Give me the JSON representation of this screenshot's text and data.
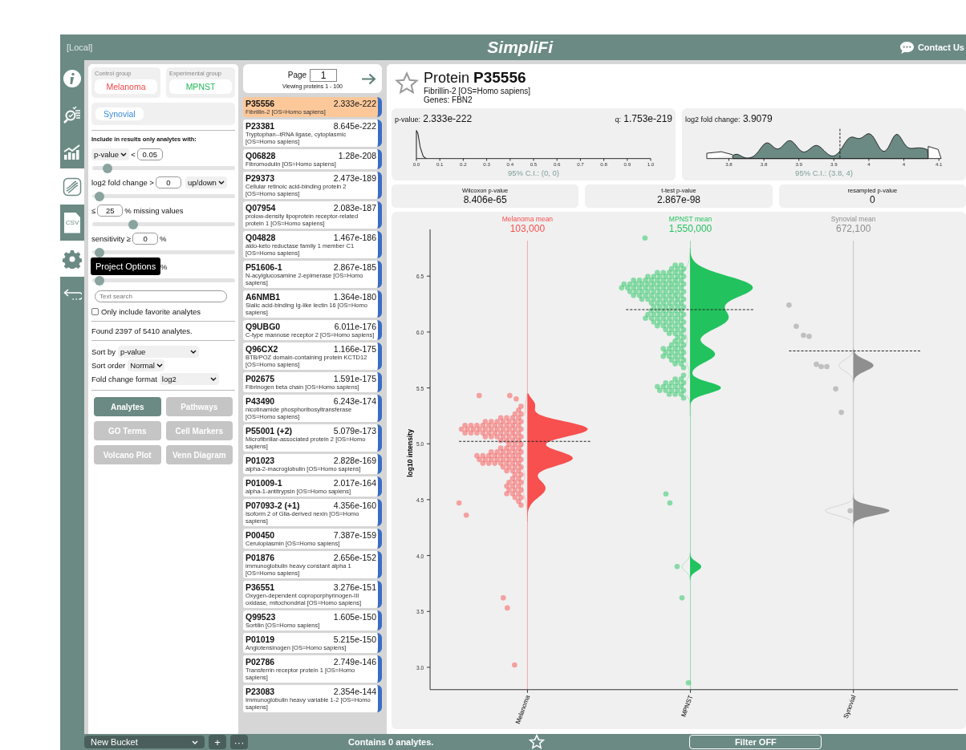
{
  "header": {
    "location": "[Local]",
    "logo": "SimpliFi",
    "contact": "Contact Us"
  },
  "rail": [
    {
      "kind": "info",
      "selected": false
    },
    {
      "kind": "search-list",
      "selected": false
    },
    {
      "kind": "chart",
      "selected": false
    },
    {
      "kind": "dna",
      "selected": true
    },
    {
      "kind": "csv",
      "label": "CSV",
      "selected": false
    },
    {
      "kind": "gear",
      "selected": true,
      "tooltip": "Project Options"
    },
    {
      "kind": "back",
      "selected": false
    }
  ],
  "groups": {
    "control": {
      "label": "Control group",
      "name": "Melanoma",
      "color": "#f04848"
    },
    "experimental": {
      "label": "Experimental group",
      "name": "MPNST",
      "color": "#22b956"
    },
    "others": [
      {
        "name": "Synovial",
        "color": "#3a8ad8"
      }
    ]
  },
  "filters": {
    "heading": "Include in results only analytes with:",
    "rows": [
      {
        "kind": "select",
        "select": "p-value",
        "op": "<",
        "value": "0.05",
        "level": 0.08
      },
      {
        "kind": "direction",
        "label": "log2 fold change >",
        "value": "0",
        "direction": "up/down",
        "level": 0.02
      },
      {
        "kind": "prefix",
        "prefix": "≤",
        "value": "25",
        "suffix": "% missing values",
        "level": 0.26
      },
      {
        "kind": "label",
        "label": "sensitivity ≥",
        "value": "0",
        "suffix": "%",
        "level": 0.02
      },
      {
        "kind": "covered",
        "suffix": "%",
        "level": 0.02
      }
    ],
    "search_placeholder": "Text search",
    "favorites": {
      "label": "Only include favorite analytes",
      "checked": false
    },
    "found": "Found 2397 of 5410 analytes.",
    "sort": [
      {
        "label": "Sort by",
        "value": "p-value"
      },
      {
        "label": "Sort order",
        "value": "Normal"
      },
      {
        "label": "Fold change format",
        "value": "log2"
      }
    ]
  },
  "views": [
    {
      "label": "Analytes",
      "selected": true
    },
    {
      "label": "Pathways",
      "selected": false
    },
    {
      "label": "GO Terms",
      "selected": false
    },
    {
      "label": "Cell Markers",
      "selected": false
    },
    {
      "label": "Volcano Plot",
      "selected": false
    },
    {
      "label": "Venn Diagram",
      "selected": false
    }
  ],
  "list": {
    "page_label": "Page",
    "page": "1",
    "viewing": "Viewing proteins 1 - 100",
    "proteins": [
      {
        "id": "P35556",
        "value": "2.333e-222",
        "desc": "Fibrillin-2 [OS=Homo sapiens]",
        "selected": true
      },
      {
        "id": "P23381",
        "value": "8.645e-222",
        "desc": "Tryptophan--tRNA ligase, cytoplasmic [OS=Homo sapiens]",
        "selected": false
      },
      {
        "id": "Q06828",
        "value": "1.28e-208",
        "desc": "Fibromodulin [OS=Homo sapiens]",
        "selected": false
      },
      {
        "id": "P29373",
        "value": "2.473e-189",
        "desc": "Cellular retinoic acid-binding protein 2 [OS=Homo sapiens]",
        "selected": false
      },
      {
        "id": "Q07954",
        "value": "2.083e-187",
        "desc": "prolow-density lipoprotein receptor-related protein 1 [OS=Homo sapiens]",
        "selected": false
      },
      {
        "id": "Q04828",
        "value": "1.467e-186",
        "desc": "aldo-keto reductase family 1 member C1 [OS=Homo sapiens]",
        "selected": false
      },
      {
        "id": "P51606-1",
        "value": "2.867e-185",
        "desc": "N-acylglucosamine 2-epimerase [OS=Homo sapiens]",
        "selected": false
      },
      {
        "id": "A6NMB1",
        "value": "1.364e-180",
        "desc": "Sialic acid-binding Ig-like lectin 16 [OS=Homo sapiens]",
        "selected": false
      },
      {
        "id": "Q9UBG0",
        "value": "6.011e-176",
        "desc": "C-type mannose receptor 2 [OS=Homo sapiens]",
        "selected": false
      },
      {
        "id": "Q96CX2",
        "value": "1.166e-175",
        "desc": "BTB/POZ domain-containing protein KCTD12 [OS=Homo sapiens]",
        "selected": false
      },
      {
        "id": "P02675",
        "value": "1.591e-175",
        "desc": "Fibrinogen beta chain [OS=Homo sapiens]",
        "selected": false
      },
      {
        "id": "P43490",
        "value": "6.243e-174",
        "desc": "nicotinamide phosphoribosyltransferase [OS=Homo sapiens]",
        "selected": false
      },
      {
        "id": "P55001 (+2)",
        "value": "5.079e-173",
        "desc": "Microfibrillar-associated protein 2 [OS=Homo sapiens]",
        "selected": false
      },
      {
        "id": "P01023",
        "value": "2.828e-169",
        "desc": "alpha-2-macroglobulin [OS=Homo sapiens]",
        "selected": false
      },
      {
        "id": "P01009-1",
        "value": "2.017e-164",
        "desc": "alpha-1-antitrypsin [OS=Homo sapiens]",
        "selected": false
      },
      {
        "id": "P07093-2 (+1)",
        "value": "4.356e-160",
        "desc": "Isoform 2 of Glia-derived nexin [OS=Homo sapiens]",
        "selected": false
      },
      {
        "id": "P00450",
        "value": "7.387e-159",
        "desc": "Ceruloplasmin [OS=Homo sapiens]",
        "selected": false
      },
      {
        "id": "P01876",
        "value": "2.656e-152",
        "desc": "immunoglobulin heavy constant alpha 1 [OS=Homo sapiens]",
        "selected": false
      },
      {
        "id": "P36551",
        "value": "3.276e-151",
        "desc": "Oxygen-dependent coproporphyrinogen-III oxidase, mitochondrial [OS=Homo sapiens]",
        "selected": false
      },
      {
        "id": "Q99523",
        "value": "1.605e-150",
        "desc": "Sortilin [OS=Homo sapiens]",
        "selected": false
      },
      {
        "id": "P01019",
        "value": "5.215e-150",
        "desc": "Angiotensinogen [OS=Homo sapiens]",
        "selected": false
      },
      {
        "id": "P02786",
        "value": "2.749e-146",
        "desc": "Transferrin receptor protein 1 [OS=Homo sapiens]",
        "selected": false
      },
      {
        "id": "P23083",
        "value": "2.354e-144",
        "desc": "Immunoglobulin heavy variable 1-2 [OS=Homo sapiens]",
        "selected": false
      }
    ]
  },
  "detail": {
    "title_prefix": "Protein",
    "id": "P35556",
    "favorite": false,
    "desc": "Fibrillin-2 [OS=Homo sapiens]",
    "genes": "Genes: FBN2",
    "pvalue": {
      "label": "p-value:",
      "value": "2.333e-222",
      "q_label": "q:",
      "q_value": "1.753e-219",
      "ticks": [
        "0.0",
        "0.1",
        "0.2",
        "0.3",
        "0.4",
        "0.5",
        "0.6",
        "0.7",
        "0.8",
        "0.9",
        "1.0"
      ],
      "ci": "95% C.I.: (0, 0)"
    },
    "fold": {
      "label": "log2 fold change:",
      "value": "3.9079",
      "ticks": [
        "3.8",
        "3.8",
        "3.9",
        "3.9",
        "4",
        "4",
        "4.1"
      ],
      "ci": "95% C.I.: (3.8, 4)"
    },
    "tests": [
      {
        "label": "Wilcoxon p-value",
        "value": "8.406e-65"
      },
      {
        "label": "t-test p-value",
        "value": "2.867e-98"
      },
      {
        "label": "resampled p-value",
        "value": "0"
      }
    ],
    "violin": {
      "ylabel": "log10 intensity",
      "yticks": [
        "6.5",
        "6.0",
        "5.5",
        "5.0",
        "4.5",
        "4.0",
        "3.5",
        "3.0"
      ],
      "groups": [
        {
          "name": "Melanoma",
          "mean_label": "Melanoma mean",
          "mean": "103,000",
          "color": "#f84f4f"
        },
        {
          "name": "MPNST",
          "mean_label": "MPNST mean",
          "mean": "1,550,000",
          "color": "#22c35e"
        },
        {
          "name": "Synovial",
          "mean_label": "Synovial mean",
          "mean": "672,100",
          "color": "#8f8f8f"
        }
      ]
    }
  },
  "bottom": {
    "bucket": "New Bucket",
    "add": "+",
    "more": "···",
    "contains": "Contains 0 analytes.",
    "filter": "Filter OFF"
  }
}
